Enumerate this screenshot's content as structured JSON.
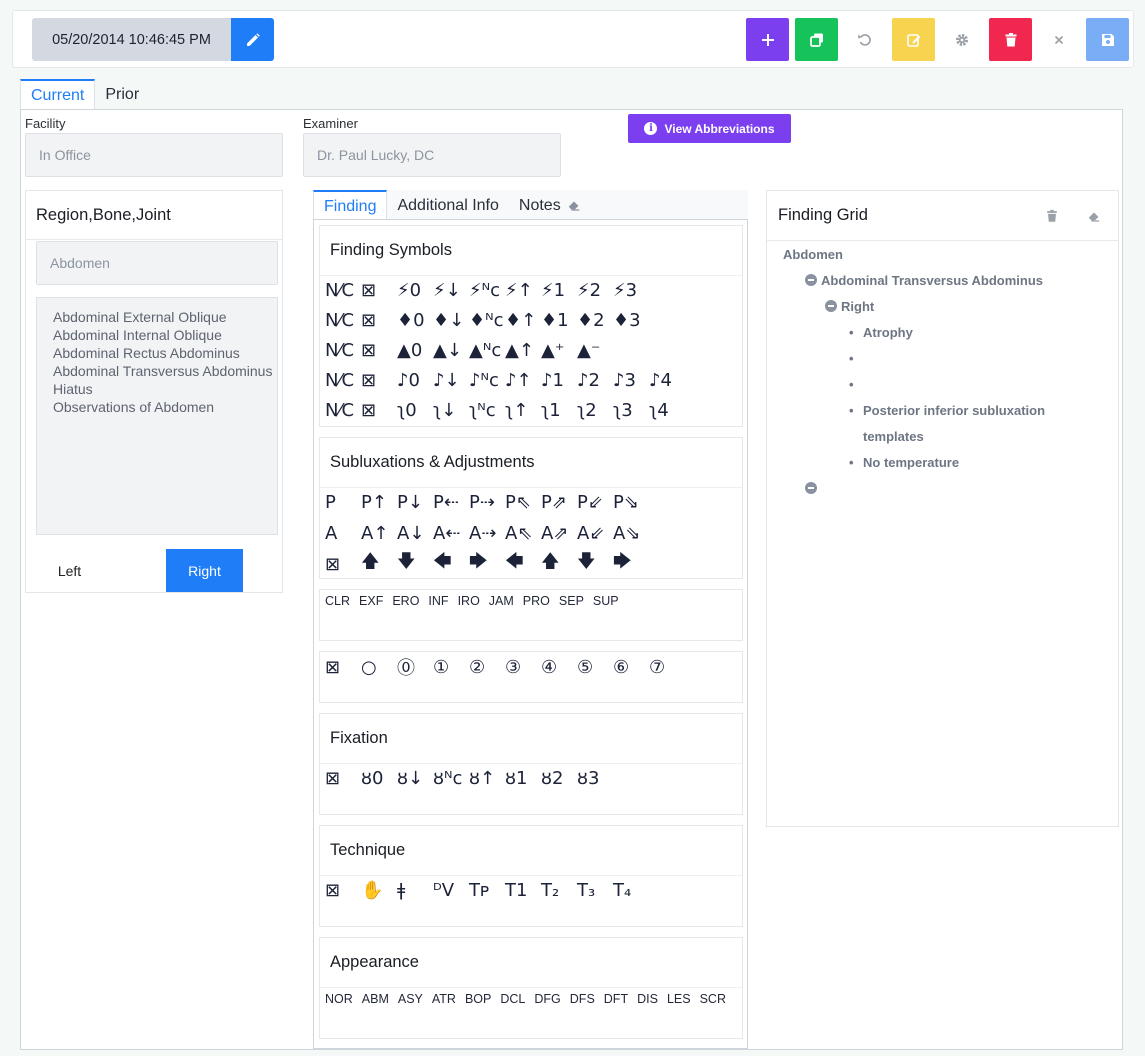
{
  "toolbar": {
    "datetime": "05/20/2014 10:46:45 PM",
    "colors": {
      "edit": "#1f7ef7",
      "add": "#7b3ff0",
      "copy": "#16c25a",
      "note": "#f8d34f",
      "delete": "#f2274f",
      "save": "#79aef7"
    }
  },
  "tabs": [
    "Current",
    "Prior"
  ],
  "facility": {
    "label": "Facility",
    "value": "In Office"
  },
  "examiner": {
    "label": "Examiner",
    "value": "Dr. Paul Lucky, DC"
  },
  "view_abbreviations": "View Abbreviations",
  "region": {
    "title": "Region,Bone,Joint",
    "selected": "Abdomen",
    "items": [
      "Abdominal External Oblique",
      "Abdominal Internal Oblique",
      "Abdominal Rectus Abdominus",
      "Abdominal Transversus Abdominus",
      "Hiatus",
      "Observations of Abdomen"
    ],
    "left": "Left",
    "right": "Right"
  },
  "finding_tabs": [
    "Finding",
    "Additional Info",
    "Notes"
  ],
  "finding_symbols": {
    "title": "Finding Symbols",
    "rows": [
      [
        "N⁄C",
        "⊠",
        "⚡0",
        "⚡↓",
        "⚡ᴺc",
        "⚡↑",
        "⚡1",
        "⚡2",
        "⚡3"
      ],
      [
        "N⁄C",
        "⊠",
        "♦0",
        "♦↓",
        "♦ᴺc",
        "♦↑",
        "♦1",
        "♦2",
        "♦3"
      ],
      [
        "N⁄C",
        "⊠",
        "▲0",
        "▲↓",
        "▲ᴺc",
        "▲↑",
        "▲⁺",
        "▲⁻"
      ],
      [
        "N⁄C",
        "⊠",
        "♪0",
        "♪↓",
        "♪ᴺc",
        "♪↑",
        "♪1",
        "♪2",
        "♪3",
        "♪4"
      ],
      [
        "N⁄C",
        "⊠",
        "ʅ0",
        "ʅ↓",
        "ʅᴺc",
        "ʅ↑",
        "ʅ1",
        "ʅ2",
        "ʅ3",
        "ʅ4"
      ]
    ]
  },
  "subluxations": {
    "title": "Subluxations & Adjustments",
    "rows": [
      [
        "P",
        "P↑",
        "P↓",
        "P⇠",
        "P⇢",
        "P⇖",
        "P⇗",
        "P⇙",
        "P⇘"
      ],
      [
        "A",
        "A↑",
        "A↓",
        "A⇠",
        "A⇢",
        "A⇖",
        "A⇗",
        "A⇙",
        "A⇘"
      ],
      [
        "⊠",
        "🡅",
        "🡇",
        "🡄",
        "🡆",
        "🡄",
        "🡅",
        "🡇",
        "🡆"
      ]
    ],
    "codes": [
      "CLR",
      "EXF",
      "ERO",
      "INF",
      "IRO",
      "JAM",
      "PRO",
      "SEP",
      "SUP"
    ],
    "circles": [
      "⊠",
      "○",
      "⓪",
      "①",
      "②",
      "③",
      "④",
      "⑤",
      "⑥",
      "⑦"
    ]
  },
  "fixation": {
    "title": "Fixation",
    "symbols": [
      "⊠",
      "ȣ0",
      "ȣ↓",
      "ȣᴺc",
      "ȣ↑",
      "ȣ1",
      "ȣ2",
      "ȣ3"
    ]
  },
  "technique": {
    "title": "Technique",
    "symbols": [
      "⊠",
      "✋",
      "ǂ",
      "ᴰV",
      "Tᴘ",
      "T1",
      "T₂",
      "T₃",
      "T₄"
    ]
  },
  "appearance": {
    "title": "Appearance",
    "codes": [
      "NOR",
      "ABM",
      "ASY",
      "ATR",
      "BOP",
      "DCL",
      "DFG",
      "DFS",
      "DFT",
      "DIS",
      "LES",
      "SCR"
    ]
  },
  "finding_grid": {
    "title": "Finding Grid",
    "root": "Abdomen",
    "muscle": "Abdominal Transversus Abdominus",
    "side": "Right",
    "findings": [
      "Atrophy",
      "",
      "",
      "Posterior inferior subluxation",
      "templates",
      "No temperature"
    ]
  }
}
